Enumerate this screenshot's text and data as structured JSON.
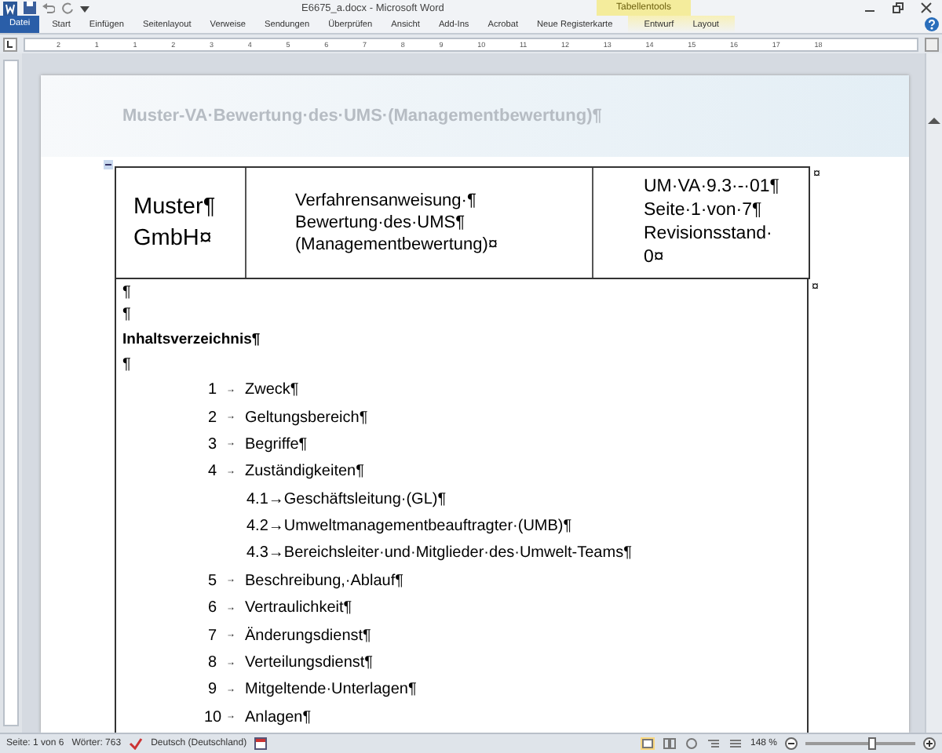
{
  "window": {
    "title": "E6675_a.docx - Microsoft Word",
    "contextual_label": "Tabellentools"
  },
  "tabs": [
    {
      "label": "Datei",
      "kind": "file"
    },
    {
      "label": "Start",
      "kind": "normal"
    },
    {
      "label": "Einfügen",
      "kind": "normal"
    },
    {
      "label": "Seitenlayout",
      "kind": "normal"
    },
    {
      "label": "Verweise",
      "kind": "normal"
    },
    {
      "label": "Sendungen",
      "kind": "normal"
    },
    {
      "label": "Überprüfen",
      "kind": "normal"
    },
    {
      "label": "Ansicht",
      "kind": "normal"
    },
    {
      "label": "Add-Ins",
      "kind": "normal"
    },
    {
      "label": "Acrobat",
      "kind": "normal"
    },
    {
      "label": "Neue Registerkarte",
      "kind": "normal"
    },
    {
      "label": "Entwurf",
      "kind": "contextual"
    },
    {
      "label": "Layout",
      "kind": "contextual"
    }
  ],
  "ruler": {
    "labels": [
      "2",
      "1",
      "1",
      "2",
      "3",
      "4",
      "5",
      "6",
      "7",
      "8",
      "9",
      "10",
      "11",
      "12",
      "13",
      "14",
      "15",
      "16",
      "17",
      "18"
    ]
  },
  "document": {
    "header_text": "Muster-VA·Bewertung·des·UMS·(Managementbewertung)¶",
    "table": {
      "cells": [
        [
          "Muster¶",
          "GmbH¤"
        ],
        [
          "Verfahrensanweisung·¶",
          "Bewertung·des·UMS¶",
          "(Managementbewertung)¤"
        ],
        [
          "UM·VA·9.3·-·01¶",
          "Seite·1·von·7¶",
          "Revisionsstand·",
          "0¤"
        ]
      ],
      "row_end": "¤",
      "body_end": "¤"
    },
    "body": [
      {
        "kind": "para",
        "text": "¶"
      },
      {
        "kind": "para",
        "text": "¶"
      },
      {
        "kind": "heading",
        "text": "Inhaltsverzeichnis¶"
      },
      {
        "kind": "para",
        "text": "¶"
      },
      {
        "kind": "toc",
        "number": "1",
        "tab": "→",
        "text": "Zweck¶"
      },
      {
        "kind": "toc",
        "number": "2",
        "tab": "→",
        "text": "Geltungsbereich¶"
      },
      {
        "kind": "toc",
        "number": "3",
        "tab": "→",
        "text": "Begriffe¶"
      },
      {
        "kind": "toc",
        "number": "4",
        "tab": "→",
        "text": "Zuständigkeiten¶",
        "children": [
          {
            "text": "4.1→Geschäftsleitung·(GL)¶"
          },
          {
            "text": "4.2→Umweltmanagementbeauftragter·(UMB)¶"
          },
          {
            "text": "4.3→Bereichsleiter·und·Mitglieder·des·Umwelt-Teams¶"
          }
        ]
      },
      {
        "kind": "toc",
        "number": "5",
        "tab": "→",
        "text": "Beschreibung,·Ablauf¶"
      },
      {
        "kind": "toc",
        "number": "6",
        "tab": "→",
        "text": "Vertraulichkeit¶"
      },
      {
        "kind": "toc",
        "number": "7",
        "tab": "→",
        "text": "Änderungsdienst¶"
      },
      {
        "kind": "toc",
        "number": "8",
        "tab": "→",
        "text": "Verteilungsdienst¶"
      },
      {
        "kind": "toc",
        "number": "9",
        "tab": "→",
        "text": "Mitgeltende·Unterlagen¶"
      },
      {
        "kind": "toc",
        "number": "10",
        "tab": "→",
        "text": "Anlagen¶"
      }
    ]
  },
  "status_bar": {
    "page": "Seite: 1 von 6",
    "words": "Wörter: 763",
    "language": "Deutsch (Deutschland)",
    "zoom": "148 %",
    "zoom_slider": {
      "level": 0.6
    }
  }
}
